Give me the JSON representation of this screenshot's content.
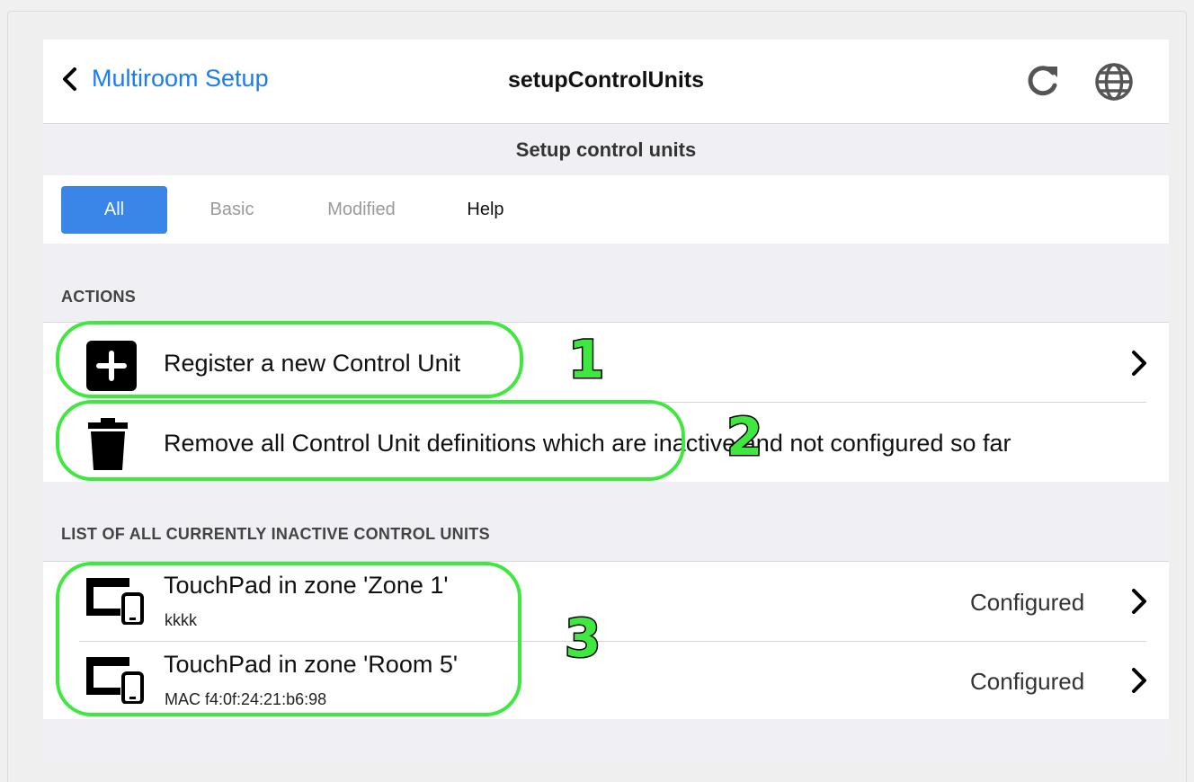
{
  "navbar": {
    "back_label": "Multiroom Setup",
    "title": "setupControlUnits",
    "icons": [
      "refresh-icon",
      "globe-icon"
    ]
  },
  "section_title": "Setup control units",
  "tabs": [
    {
      "label": "All",
      "state": "active"
    },
    {
      "label": "Basic",
      "state": "muted"
    },
    {
      "label": "Modified",
      "state": "muted"
    },
    {
      "label": "Help",
      "state": "normal"
    }
  ],
  "actions": {
    "header": "ACTIONS",
    "items": [
      {
        "label": "Register a new Control Unit",
        "icon": "plus-square-icon"
      },
      {
        "label": "Remove all Control Unit definitions which are inactive and not configured so far",
        "icon": "trash-icon"
      }
    ]
  },
  "inactive_units": {
    "header": "LIST OF ALL CURRENTLY INACTIVE CONTROL UNITS",
    "items": [
      {
        "title": "TouchPad in zone 'Zone 1'",
        "subtitle": "kkkk",
        "status": "Configured",
        "icon": "devices-icon"
      },
      {
        "title": "TouchPad in zone 'Room 5'",
        "subtitle": "MAC f4:0f:24:21:b6:98",
        "status": "Configured",
        "icon": "devices-icon"
      }
    ]
  },
  "annotations": [
    "1",
    "2",
    "3"
  ],
  "colors": {
    "accent": "#3a86e8",
    "link": "#1a7cf0",
    "highlight": "#3ee83e"
  }
}
